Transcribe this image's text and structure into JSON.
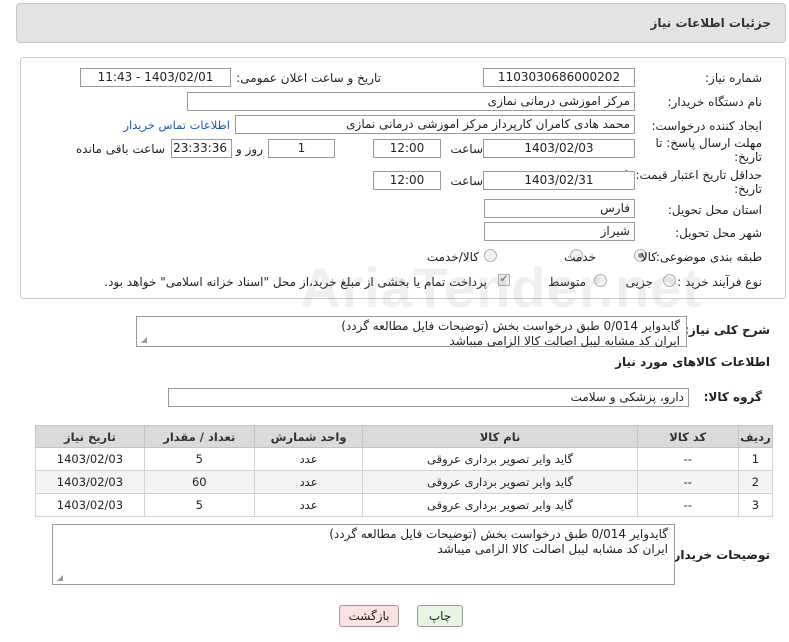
{
  "header": {
    "title": "جزئیات اطلاعات نیاز"
  },
  "form": {
    "need_number": {
      "label": "شماره نیاز:",
      "value": "1103030686000202"
    },
    "announce_datetime": {
      "label": "تاریخ و ساعت اعلان عمومی:",
      "value": "1403/02/01 - 11:43"
    },
    "buyer_org": {
      "label": "نام دستگاه خریدار:",
      "value": "مرکز اموزشی درمانی نمازی"
    },
    "requester": {
      "label": "ایجاد کننده درخواست:",
      "value": "محمد هادی کامران کارپرداز مرکز اموزشی درمانی نمازی",
      "contact_link": "اطلاعات تماس خریدار"
    },
    "reply_deadline": {
      "label_line1": "مهلت ارسال پاسخ: تا",
      "label_line2": "تاریخ:",
      "date": "1403/02/03",
      "time_label": "ساعت",
      "time": "12:00",
      "days": "1",
      "days_label": "روز و",
      "remaining": "23:33:36",
      "remaining_label": "ساعت باقی مانده"
    },
    "price_validity": {
      "label_line1": "حداقل تاریخ اعتبار قیمت: تا",
      "label_line2": "تاریخ:",
      "date": "1403/02/31",
      "time_label": "ساعت",
      "time": "12:00"
    },
    "province": {
      "label": "استان محل تحویل:",
      "value": "فارس"
    },
    "city": {
      "label": "شهر محل تحویل:",
      "value": "شیراز"
    },
    "category": {
      "label": "طبقه بندی موضوعی:",
      "options": [
        "کالا",
        "خدمت",
        "کالا/خدمت"
      ],
      "selected": "کالا"
    },
    "process_type": {
      "label": "نوع فرآیند خرید :",
      "options": [
        "جزیی",
        "متوسط"
      ],
      "note": "پرداخت تمام یا بخشی از مبلغ خرید،از محل \"اسناد خزانه اسلامی\" خواهد بود."
    }
  },
  "general_desc": {
    "label": "شرح کلی نیاز:",
    "lines": [
      "گایدوایر 0/014 طبق درخواست بخش (توضیحات فایل مطالعه گردد)",
      "ایران کد مشابه لیبل اصالت کالا الزامی میباشد"
    ]
  },
  "goods_section": {
    "title": "اطلاعات کالاهای مورد نیاز",
    "group_label": "گروه کالا:",
    "group_value": "دارو، پزشکی و سلامت"
  },
  "table": {
    "columns": [
      "ردیف",
      "کد کالا",
      "نام کالا",
      "واحد شمارش",
      "تعداد / مقدار",
      "تاریخ نیاز"
    ],
    "rows": [
      [
        "1",
        "--",
        "گاید وایر تصویر برداری عروقی",
        "عدد",
        "5",
        "1403/02/03"
      ],
      [
        "2",
        "--",
        "گاید وایر تصویر برداری عروقی",
        "عدد",
        "60",
        "1403/02/03"
      ],
      [
        "3",
        "--",
        "گاید وایر تصویر برداری عروقی",
        "عدد",
        "5",
        "1403/02/03"
      ]
    ]
  },
  "buyer_notes": {
    "label": "توضیحات خریدار:",
    "lines": [
      "گایدوایر 0/014 طبق درخواست بخش (توضیحات فایل مطالعه گردد)",
      "ایران کد مشابه لیبل اصالت کالا الزامی میباشد"
    ]
  },
  "buttons": {
    "print": "چاپ",
    "back": "بازگشت"
  },
  "watermark": "AriaTender.net",
  "colors": {
    "link": "#1f57b3",
    "print_button_bg": "#e6f6e1",
    "back_button_bg": "#fbe1e1"
  }
}
